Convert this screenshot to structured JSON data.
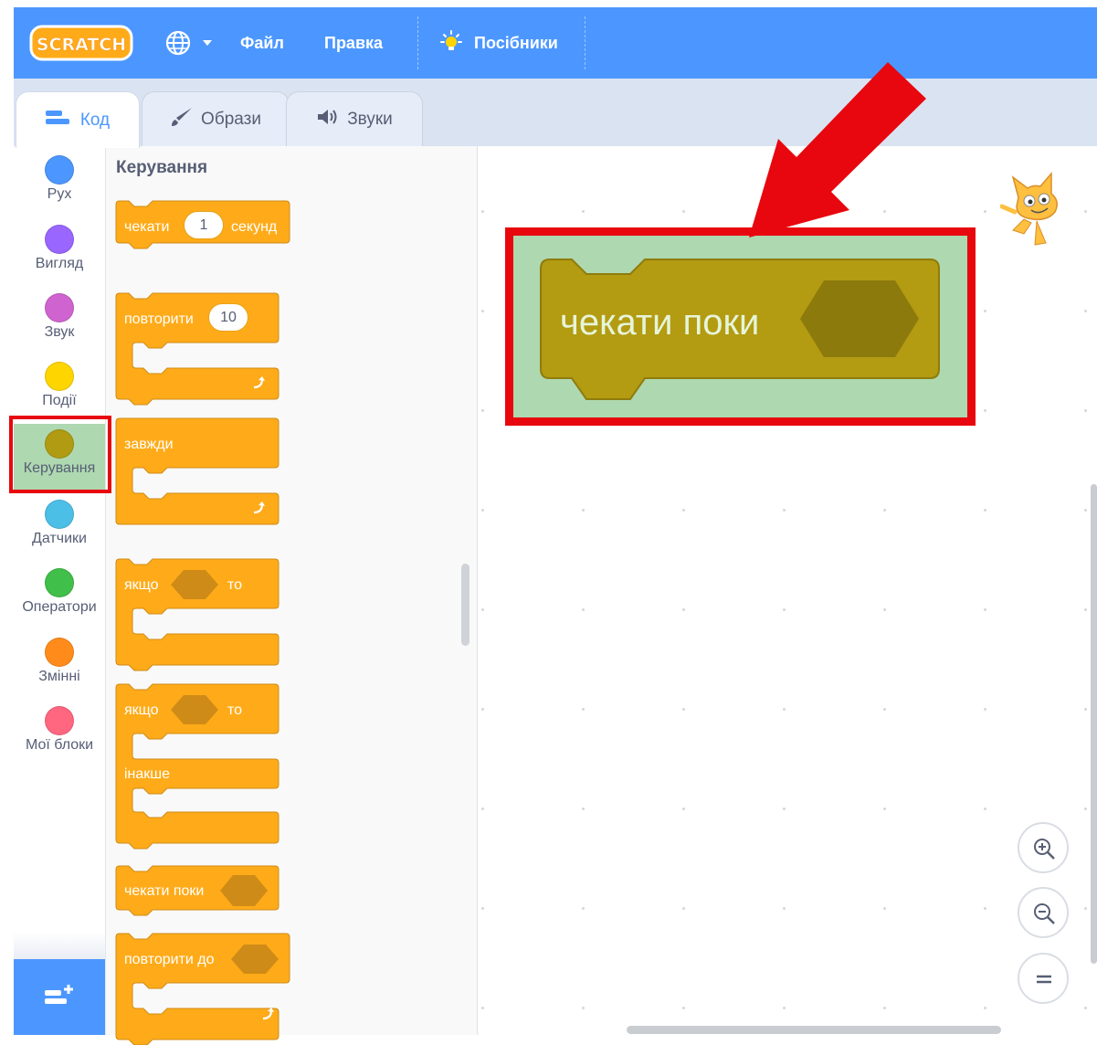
{
  "menubar": {
    "logo_text": "SCRATCH",
    "language_icon": "globe-icon",
    "file_label": "Файл",
    "edit_label": "Правка",
    "tutorials_label": "Посібники",
    "tutorials_icon": "lightbulb-icon"
  },
  "tabs": [
    {
      "label": "Код",
      "icon": "code-icon",
      "active": true
    },
    {
      "label": "Образи",
      "icon": "brush-icon",
      "active": false
    },
    {
      "label": "Звуки",
      "icon": "speaker-icon",
      "active": false
    }
  ],
  "categories": [
    {
      "label": "Рух",
      "color": "#4c97ff"
    },
    {
      "label": "Вигляд",
      "color": "#9966ff"
    },
    {
      "label": "Звук",
      "color": "#cf63cf"
    },
    {
      "label": "Події",
      "color": "#ffd500"
    },
    {
      "label": "Керування",
      "color": "#b09b12",
      "selected": true
    },
    {
      "label": "Датчики",
      "color": "#4cbfe6"
    },
    {
      "label": "Оператори",
      "color": "#40bf4a"
    },
    {
      "label": "Змінні",
      "color": "#ff8c1a"
    },
    {
      "label": "Мої блоки",
      "color": "#ff6680"
    }
  ],
  "palette": {
    "title": "Керування",
    "blocks": {
      "wait_seconds": {
        "prefix": "чекати",
        "value": "1",
        "suffix": "секунд"
      },
      "repeat": {
        "prefix": "повторити",
        "value": "10"
      },
      "forever": {
        "label": "завжди"
      },
      "if_then": {
        "prefix": "якщо",
        "suffix": "то"
      },
      "if_else": {
        "prefix": "якщо",
        "suffix": "то",
        "else_label": "інакше"
      },
      "wait_until": {
        "label": "чекати поки"
      },
      "repeat_until": {
        "label": "повторити до"
      }
    }
  },
  "workspace": {
    "highlighted_block": {
      "label": "чекати поки"
    }
  },
  "colors": {
    "accent": "#4c97ff",
    "control_block": "#ffab19",
    "control_selected": "#b09b12",
    "highlight": "#e8070e",
    "highlight_fill": "#aed8b0"
  },
  "zoom_controls": [
    "zoom-in-icon",
    "zoom-out-icon",
    "zoom-reset-icon"
  ]
}
